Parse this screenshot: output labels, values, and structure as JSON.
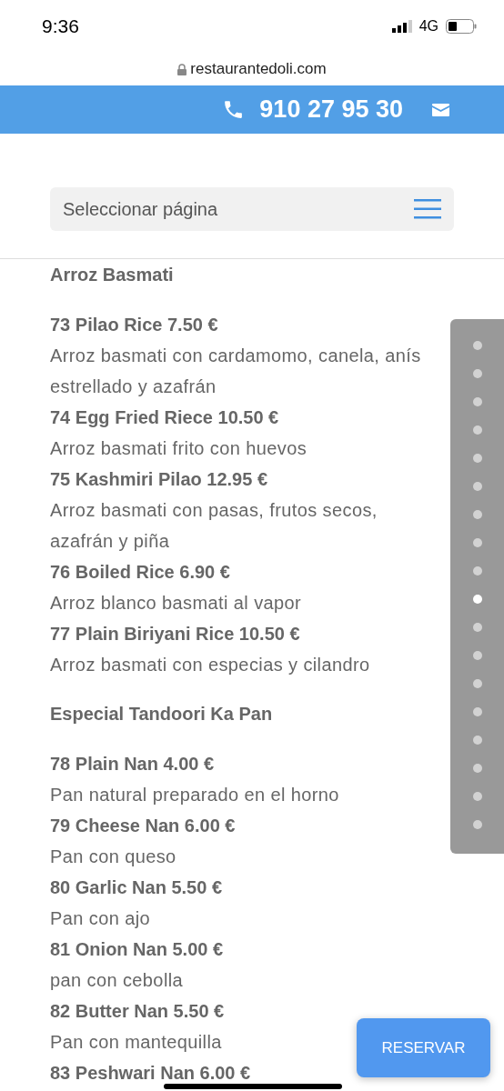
{
  "status_bar": {
    "time": "9:36",
    "network": "4G"
  },
  "address_bar": {
    "url": "restaurantedoli.com"
  },
  "header": {
    "phone": "910 27 95 30"
  },
  "page_select": {
    "label": "Seleccionar página"
  },
  "sections": [
    {
      "title": "Arroz Basmati",
      "items": [
        {
          "name": "73 Pilao Rice 7.50 €",
          "description": "Arroz basmati con cardamomo, canela, anís estrellado y azafrán"
        },
        {
          "name": "74 Egg Fried Riece 10.50 €",
          "description": "Arroz basmati frito con huevos"
        },
        {
          "name": "75 Kashmiri Pilao 12.95 €",
          "description": "Arroz basmati con pasas, frutos secos, azafrán y piña"
        },
        {
          "name": "76 Boiled Rice 6.90 €",
          "description": "Arroz blanco basmati al vapor"
        },
        {
          "name": "77 Plain Biriyani Rice 10.50 €",
          "description": "Arroz basmati con especias y cilandro"
        }
      ]
    },
    {
      "title": "Especial Tandoori Ka Pan",
      "items": [
        {
          "name": "78 Plain Nan 4.00 €",
          "description": "Pan natural preparado en el horno"
        },
        {
          "name": "79 Cheese Nan 6.00 €",
          "description": "Pan con queso"
        },
        {
          "name": "80 Garlic Nan 5.50 €",
          "description": "Pan con ajo"
        },
        {
          "name": "81 Onion Nan 5.00 €",
          "description": "pan con cebolla"
        },
        {
          "name": "82 Butter Nan 5.50 €",
          "description": "Pan con mantequilla"
        },
        {
          "name": "83 Peshwari Nan 6.00 €"
        }
      ]
    }
  ],
  "section_dots": [
    {
      "selected": false
    },
    {
      "selected": false
    },
    {
      "selected": false
    },
    {
      "selected": false
    },
    {
      "selected": false
    },
    {
      "selected": false
    },
    {
      "selected": false
    },
    {
      "selected": false
    },
    {
      "selected": false
    },
    {
      "selected": true
    },
    {
      "selected": false
    },
    {
      "selected": false
    },
    {
      "selected": false
    },
    {
      "selected": false
    },
    {
      "selected": false
    },
    {
      "selected": false
    },
    {
      "selected": false
    },
    {
      "selected": false
    }
  ],
  "reserve_button": {
    "label": "RESERVAR"
  }
}
